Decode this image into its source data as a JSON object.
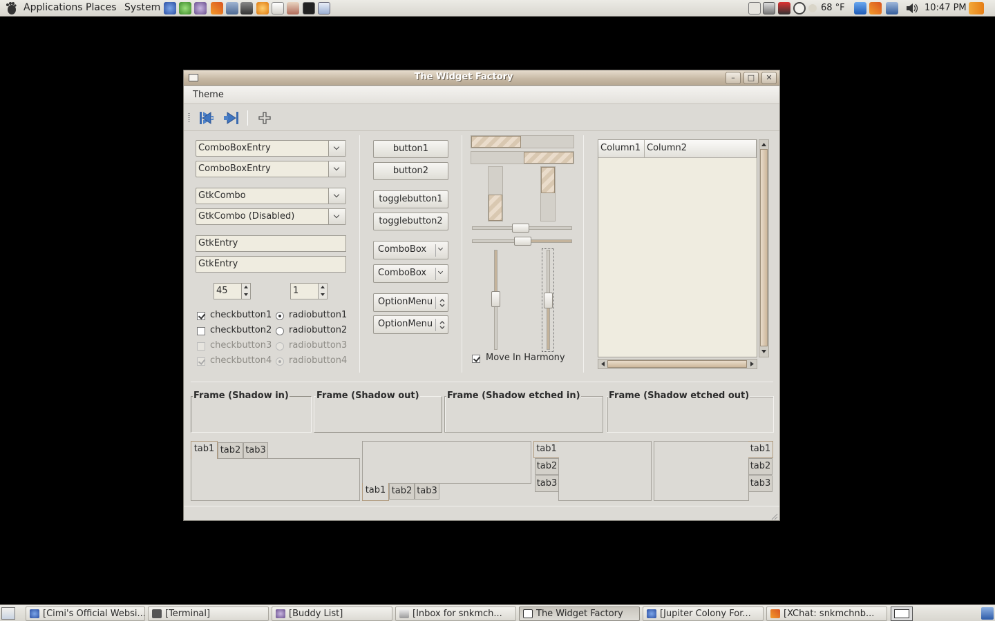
{
  "top_panel": {
    "menus": [
      "Applications",
      "Places",
      "System"
    ],
    "weather": "68 °F",
    "clock": "10:47 PM",
    "launchers": [
      "firefox-icon",
      "network-icon",
      "pidgin-icon",
      "xchat-icon",
      "file-manager-icon",
      "thunderbird-icon",
      "burner-icon",
      "text-editor-icon",
      "package-icon",
      "terminal-icon",
      "screenshot-icon"
    ]
  },
  "window": {
    "title": "The Widget Factory",
    "menu": [
      "Theme"
    ],
    "wm_buttons": {
      "minimize": "–",
      "maximize": "□",
      "close": "✕"
    }
  },
  "left_col": {
    "combo_entries": [
      "ComboBoxEntry",
      "ComboBoxEntry"
    ],
    "gtk_combos": [
      "GtkCombo",
      "GtkCombo (Disabled)"
    ],
    "entries": [
      "GtkEntry",
      "GtkEntry"
    ],
    "spins": [
      "45",
      "1"
    ],
    "checks": [
      {
        "label": "checkbutton1",
        "checked": true,
        "disabled": false
      },
      {
        "label": "checkbutton2",
        "checked": false,
        "disabled": false
      },
      {
        "label": "checkbutton3",
        "checked": false,
        "disabled": true
      },
      {
        "label": "checkbutton4",
        "checked": true,
        "disabled": true
      }
    ],
    "radios": [
      {
        "label": "radiobutton1",
        "checked": true,
        "disabled": false
      },
      {
        "label": "radiobutton2",
        "checked": false,
        "disabled": false
      },
      {
        "label": "radiobutton3",
        "checked": false,
        "disabled": true
      },
      {
        "label": "radiobutton4",
        "checked": true,
        "disabled": true
      }
    ]
  },
  "mid_col": {
    "buttons": [
      "button1",
      "button2"
    ],
    "toggles": [
      "togglebutton1",
      "togglebutton2"
    ],
    "comboboxes": [
      "ComboBox",
      "ComboBox"
    ],
    "option_menus": [
      "OptionMenu",
      "OptionMenu"
    ]
  },
  "ranges": {
    "hprogress": [
      0.5,
      0.5
    ],
    "vprogress": [
      0.5,
      0.5
    ],
    "hscale": [
      0.5,
      0.5
    ],
    "vscale": [
      0.5,
      0.5
    ],
    "harmony_label": "Move In Harmony",
    "harmony_checked": true
  },
  "tree": {
    "columns": [
      "Column1",
      "Column2"
    ]
  },
  "frames": [
    "Frame (Shadow in)",
    "Frame (Shadow out)",
    "Frame (Shadow etched in)",
    "Frame (Shadow etched out)"
  ],
  "notebooks": {
    "tabs": [
      "tab1",
      "tab2",
      "tab3"
    ]
  },
  "taskbar": {
    "tasks": [
      {
        "label": "[Cimi's Official Websi...",
        "icon": "firefox-icon",
        "active": false
      },
      {
        "label": "[Terminal]",
        "icon": "terminal-icon",
        "active": false
      },
      {
        "label": "[Buddy List]",
        "icon": "pidgin-icon",
        "active": false
      },
      {
        "label": "[Inbox for snkmch...",
        "icon": "mail-icon",
        "active": false
      },
      {
        "label": "The Widget Factory",
        "icon": "window-icon",
        "active": true
      },
      {
        "label": "[Jupiter Colony For...",
        "icon": "firefox-icon",
        "active": false
      },
      {
        "label": "[XChat: snkmchnb...",
        "icon": "xchat-icon",
        "active": false
      }
    ]
  },
  "colors": {
    "accent": "#c6b8a3",
    "window_bg": "#dcdad5",
    "entry_bg": "#efece0",
    "desktop": "#000000"
  }
}
